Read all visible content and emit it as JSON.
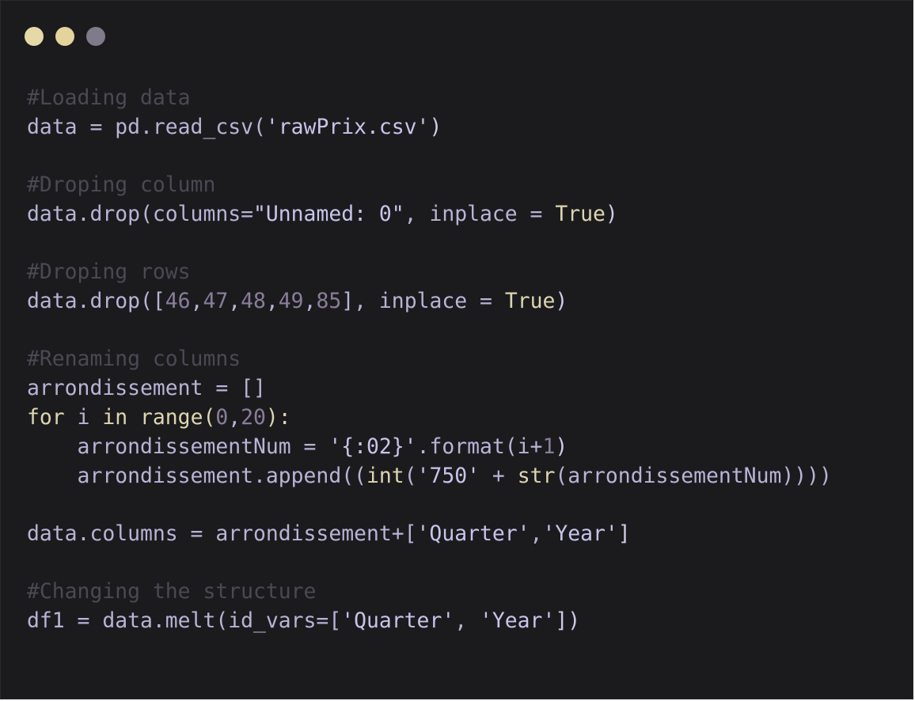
{
  "window": {
    "controls": [
      {
        "name": "close-dot",
        "color": "#e6d9a8"
      },
      {
        "name": "minimize-dot",
        "color": "#e2d49c"
      },
      {
        "name": "maximize-dot",
        "color": "#807b8a"
      }
    ]
  },
  "colors": {
    "background": "#1b1b1e",
    "comment": "#4a4954",
    "identifier": "#b8b4d6",
    "string": "#c8c4ea",
    "keyword": "#ded6b0",
    "number": "#8a7d9a",
    "punctuation": "#cfcbe6"
  },
  "code": {
    "lines": [
      {
        "tokens": [
          {
            "t": "#Loading data",
            "k": "comment"
          }
        ]
      },
      {
        "tokens": [
          {
            "t": "data = pd.read_csv(",
            "k": "identifier"
          },
          {
            "t": "'rawPrix.csv'",
            "k": "string"
          },
          {
            "t": ")",
            "k": "punctuation"
          }
        ]
      },
      {
        "gap": true
      },
      {
        "tokens": [
          {
            "t": "#Droping column",
            "k": "comment"
          }
        ]
      },
      {
        "tokens": [
          {
            "t": "data.drop(columns=",
            "k": "identifier"
          },
          {
            "t": "\"Unnamed: 0\"",
            "k": "string"
          },
          {
            "t": ", inplace = ",
            "k": "identifier"
          },
          {
            "t": "True",
            "k": "keyword"
          },
          {
            "t": ")",
            "k": "punctuation"
          }
        ]
      },
      {
        "gap": true
      },
      {
        "tokens": [
          {
            "t": "#Droping rows",
            "k": "comment"
          }
        ]
      },
      {
        "tokens": [
          {
            "t": "data.drop([",
            "k": "identifier"
          },
          {
            "t": "46",
            "k": "number"
          },
          {
            "t": ",",
            "k": "identifier"
          },
          {
            "t": "47",
            "k": "number"
          },
          {
            "t": ",",
            "k": "identifier"
          },
          {
            "t": "48",
            "k": "number"
          },
          {
            "t": ",",
            "k": "identifier"
          },
          {
            "t": "49",
            "k": "number"
          },
          {
            "t": ",",
            "k": "identifier"
          },
          {
            "t": "85",
            "k": "number"
          },
          {
            "t": "], inplace = ",
            "k": "identifier"
          },
          {
            "t": "True",
            "k": "keyword"
          },
          {
            "t": ")",
            "k": "punctuation"
          }
        ]
      },
      {
        "gap": true
      },
      {
        "tokens": [
          {
            "t": "#Renaming columns",
            "k": "comment"
          }
        ]
      },
      {
        "tokens": [
          {
            "t": "arrondissement = []",
            "k": "identifier"
          }
        ]
      },
      {
        "tokens": [
          {
            "t": "for",
            "k": "keyword"
          },
          {
            "t": " i ",
            "k": "identifier"
          },
          {
            "t": "in",
            "k": "keyword"
          },
          {
            "t": " range(",
            "k": "keyword"
          },
          {
            "t": "0",
            "k": "number"
          },
          {
            "t": ",",
            "k": "identifier"
          },
          {
            "t": "20",
            "k": "number"
          },
          {
            "t": "):",
            "k": "keyword"
          }
        ]
      },
      {
        "tokens": [
          {
            "t": "    arrondissementNum = ",
            "k": "identifier"
          },
          {
            "t": "'{:02}'",
            "k": "string"
          },
          {
            "t": ".format(i+",
            "k": "identifier"
          },
          {
            "t": "1",
            "k": "number"
          },
          {
            "t": ")",
            "k": "punctuation"
          }
        ]
      },
      {
        "tokens": [
          {
            "t": "    arrondissement.append((",
            "k": "identifier"
          },
          {
            "t": "int",
            "k": "keyword"
          },
          {
            "t": "(",
            "k": "identifier"
          },
          {
            "t": "'750'",
            "k": "string"
          },
          {
            "t": " + ",
            "k": "identifier"
          },
          {
            "t": "str",
            "k": "keyword"
          },
          {
            "t": "(arrondissementNum))))",
            "k": "identifier"
          }
        ]
      },
      {
        "gap": true
      },
      {
        "tokens": [
          {
            "t": "data.columns = arrondissement+[",
            "k": "identifier"
          },
          {
            "t": "'Quarter'",
            "k": "string"
          },
          {
            "t": ",",
            "k": "identifier"
          },
          {
            "t": "'Year'",
            "k": "string"
          },
          {
            "t": "]",
            "k": "punctuation"
          }
        ]
      },
      {
        "gap": true
      },
      {
        "tokens": [
          {
            "t": "#Changing the structure",
            "k": "comment"
          }
        ]
      },
      {
        "tokens": [
          {
            "t": "df1 = data.melt(id_vars=[",
            "k": "identifier"
          },
          {
            "t": "'Quarter'",
            "k": "string"
          },
          {
            "t": ", ",
            "k": "identifier"
          },
          {
            "t": "'Year'",
            "k": "string"
          },
          {
            "t": "])",
            "k": "punctuation"
          }
        ]
      }
    ]
  }
}
